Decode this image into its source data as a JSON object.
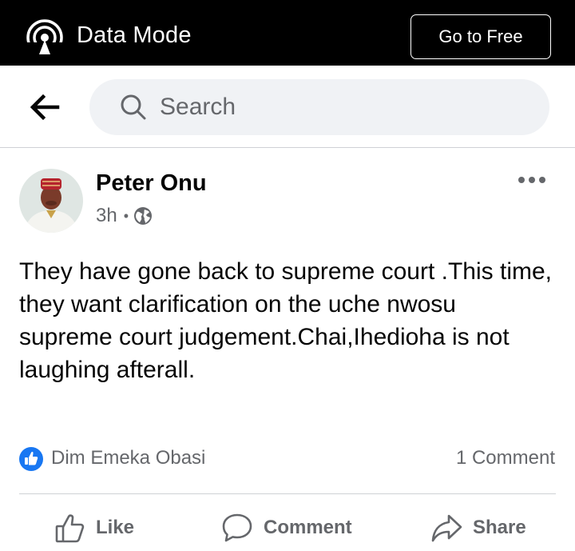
{
  "topbar": {
    "title": "Data Mode",
    "button_label": "Go to Free"
  },
  "search": {
    "placeholder": "Search"
  },
  "post": {
    "author": "Peter Onu",
    "time": "3h",
    "separator": "•",
    "text": "They have gone back to supreme court .This time,\nthey want clarification on the uche nwosu supreme court judgement.Chai,Ihedioha is not laughing afterall.",
    "reaction_by": "Dim Emeka Obasi",
    "comment_count": "1 Comment"
  },
  "actions": {
    "like": "Like",
    "comment": "Comment",
    "share": "Share"
  },
  "colors": {
    "topbar_bg": "#000000",
    "like_blue": "#1877f2",
    "muted_text": "#65676b",
    "search_bg": "#f0f2f5"
  },
  "icons": [
    "data-mode-icon",
    "back-arrow-icon",
    "search-icon",
    "globe-icon",
    "more-options-icon",
    "like-reaction-icon",
    "thumbs-up-icon",
    "comment-icon",
    "share-icon"
  ]
}
